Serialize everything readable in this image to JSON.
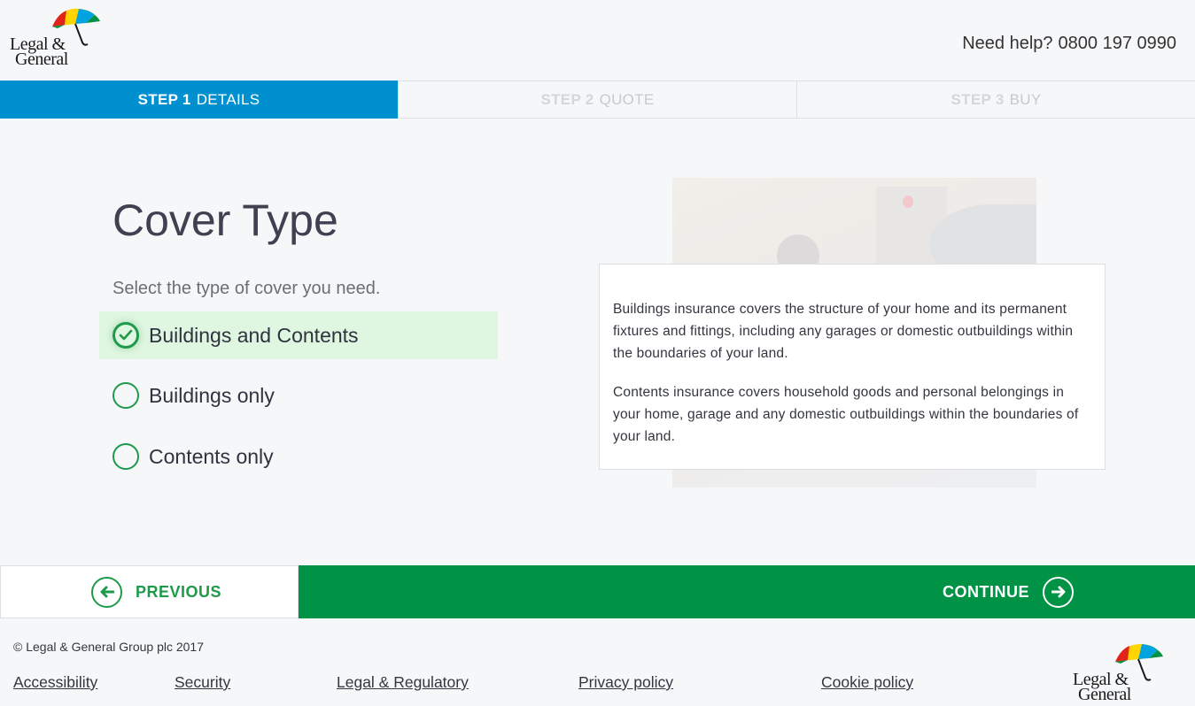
{
  "header": {
    "logo_line1": "Legal &",
    "logo_line2": "General",
    "help_label": "Need help?",
    "help_phone": "0800 197 0990"
  },
  "steps": [
    {
      "num": "STEP 1",
      "label": "DETAILS",
      "state": "active"
    },
    {
      "num": "STEP 2",
      "label": "QUOTE",
      "state": "inactive"
    },
    {
      "num": "STEP 3",
      "label": "BUY",
      "state": "inactive"
    }
  ],
  "main": {
    "title": "Cover Type",
    "subtitle": "Select the type of cover you need.",
    "options": [
      {
        "label": "Buildings and Contents",
        "selected": true
      },
      {
        "label": "Buildings only",
        "selected": false
      },
      {
        "label": "Contents only",
        "selected": false
      }
    ],
    "info": [
      "Buildings insurance covers the structure of your home and its permanent fixtures and fittings, including any garages or domestic outbuildings within the boundaries of your land.",
      "Contents insurance covers household goods and personal belongings in your home, garage and any domestic outbuildings within the boundaries of your land."
    ]
  },
  "nav": {
    "previous_label": "PREVIOUS",
    "continue_label": "CONTINUE"
  },
  "footer": {
    "copyright": "© Legal & General Group plc 2017",
    "links": [
      "Accessibility",
      "Security",
      "Legal & Regulatory",
      "Privacy policy",
      "Cookie policy"
    ]
  },
  "colors": {
    "step_active": "#0090cf",
    "accent_green": "#009245",
    "selected_bg": "#dff6e0"
  }
}
